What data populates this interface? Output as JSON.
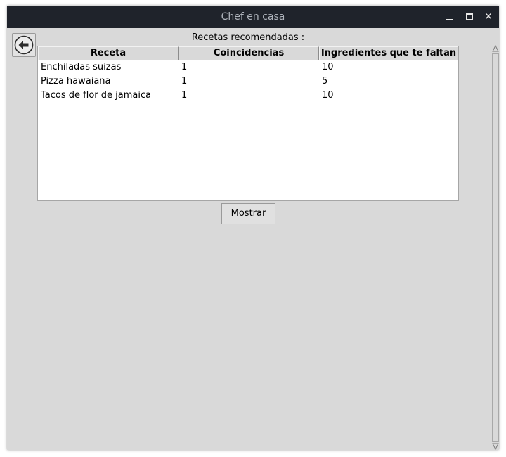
{
  "window": {
    "title": "Chef en casa"
  },
  "heading": "Recetas recomendadas :",
  "table": {
    "columns": [
      "Receta",
      "Coincidencias",
      "Ingredientes que te faltan"
    ],
    "rows": [
      [
        "Enchiladas suizas",
        "1",
        "10"
      ],
      [
        "Pizza hawaiana",
        "1",
        "5"
      ],
      [
        "Tacos de flor de jamaica",
        "1",
        "10"
      ]
    ]
  },
  "buttons": {
    "show_label": "Mostrar"
  },
  "icons": {
    "back": "arrow-left-circle-icon",
    "minimize": "minimize-icon",
    "maximize": "maximize-icon",
    "close": "close-icon",
    "scroll_up": "triangle-up-icon",
    "scroll_down": "triangle-down-icon"
  },
  "colors": {
    "titlebar": "#1f232b",
    "window_bg": "#d9d9d9",
    "table_bg": "#ffffff"
  }
}
